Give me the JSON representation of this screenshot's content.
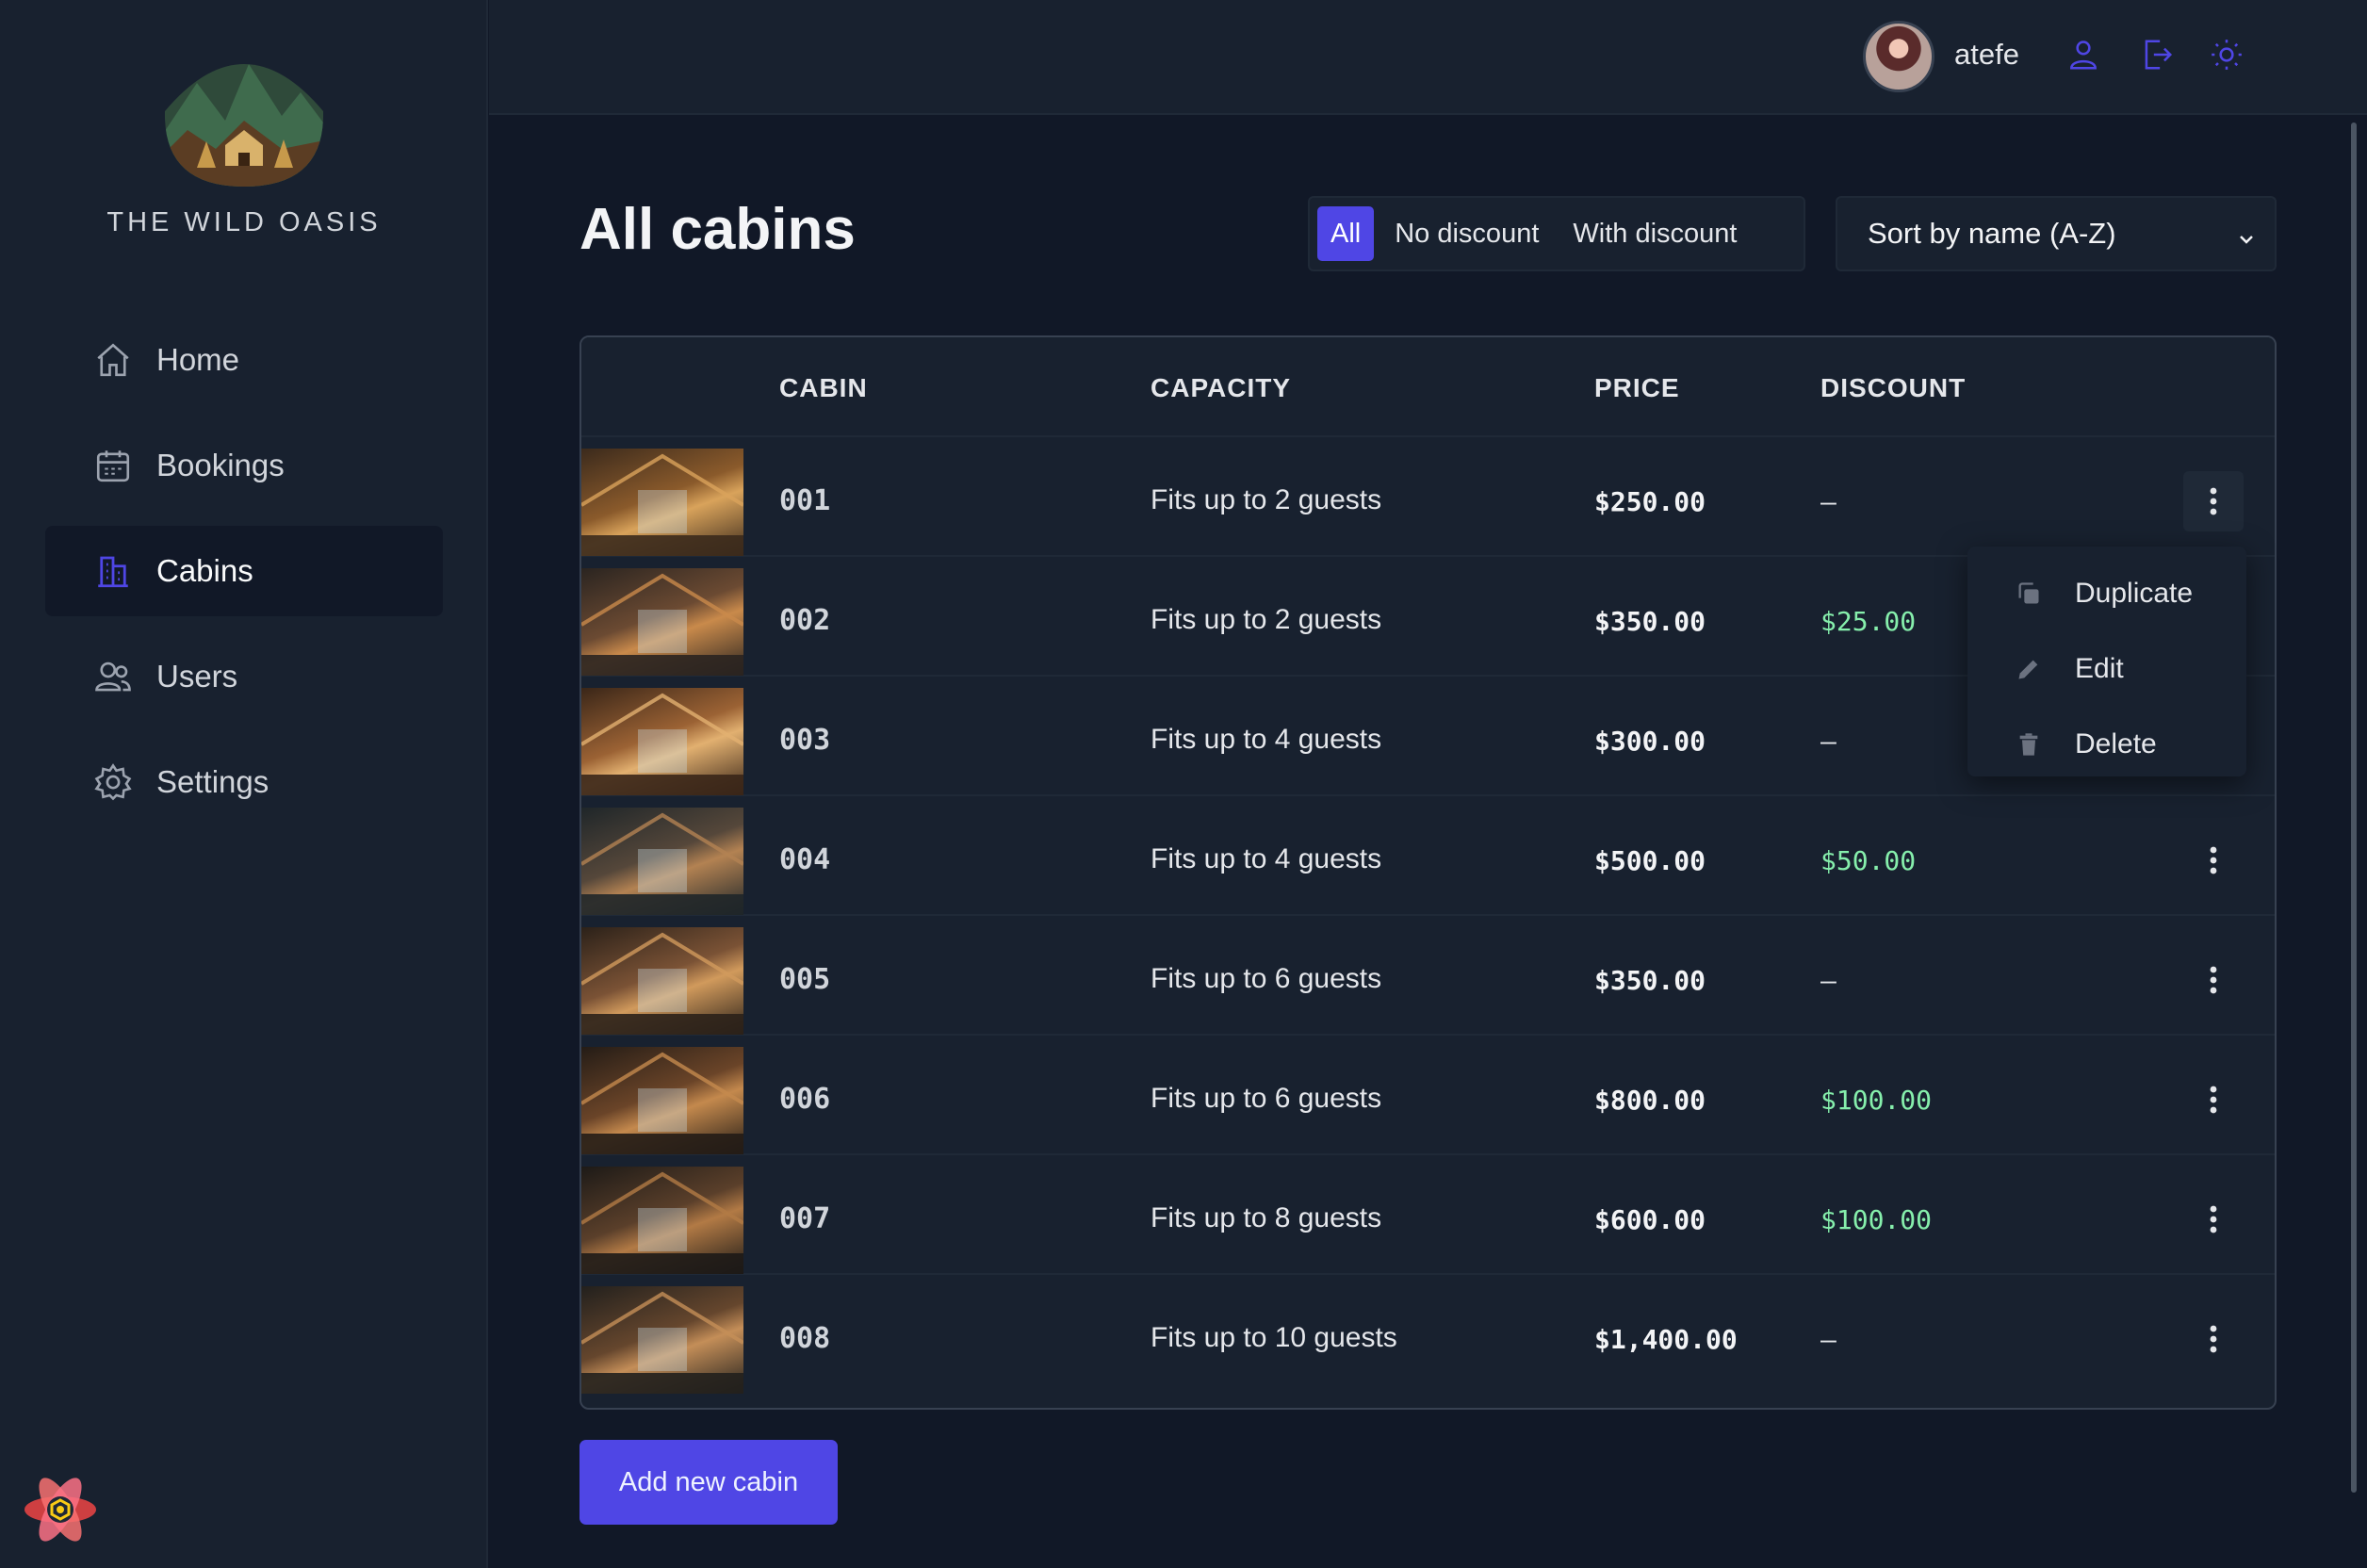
{
  "brand": {
    "name": "THE WILD OASIS",
    "logo_icon": "mountain-cabin-logo"
  },
  "sidebar": {
    "items": [
      {
        "label": "Home",
        "icon": "home-icon",
        "active": false
      },
      {
        "label": "Bookings",
        "icon": "calendar-icon",
        "active": false
      },
      {
        "label": "Cabins",
        "icon": "building-icon",
        "active": true
      },
      {
        "label": "Users",
        "icon": "users-icon",
        "active": false
      },
      {
        "label": "Settings",
        "icon": "gear-icon",
        "active": false
      }
    ],
    "footer_icon": "react-query-devtools-icon"
  },
  "header": {
    "username": "atefe",
    "icons": [
      "user-icon",
      "logout-icon",
      "sun-icon"
    ]
  },
  "page": {
    "title": "All cabins",
    "filters": [
      {
        "label": "All",
        "active": true
      },
      {
        "label": "No discount",
        "active": false
      },
      {
        "label": "With discount",
        "active": false
      }
    ],
    "sort": {
      "selected": "Sort by name (A-Z)"
    }
  },
  "table": {
    "headers": {
      "image": "",
      "cabin": "CABIN",
      "capacity": "CAPACITY",
      "price": "PRICE",
      "discount": "DISCOUNT"
    },
    "rows": [
      {
        "cabin": "001",
        "capacity": "Fits up to 2 guests",
        "price": "$250.00",
        "discount": "—"
      },
      {
        "cabin": "002",
        "capacity": "Fits up to 2 guests",
        "price": "$350.00",
        "discount": "$25.00"
      },
      {
        "cabin": "003",
        "capacity": "Fits up to 4 guests",
        "price": "$300.00",
        "discount": "—"
      },
      {
        "cabin": "004",
        "capacity": "Fits up to 4 guests",
        "price": "$500.00",
        "discount": "$50.00"
      },
      {
        "cabin": "005",
        "capacity": "Fits up to 6 guests",
        "price": "$350.00",
        "discount": "—"
      },
      {
        "cabin": "006",
        "capacity": "Fits up to 6 guests",
        "price": "$800.00",
        "discount": "$100.00"
      },
      {
        "cabin": "007",
        "capacity": "Fits up to 8 guests",
        "price": "$600.00",
        "discount": "$100.00"
      },
      {
        "cabin": "008",
        "capacity": "Fits up to 10 guests",
        "price": "$1,400.00",
        "discount": "—"
      }
    ]
  },
  "context_menu": {
    "items": [
      {
        "label": "Duplicate",
        "icon": "duplicate-icon"
      },
      {
        "label": "Edit",
        "icon": "pencil-icon"
      },
      {
        "label": "Delete",
        "icon": "trash-icon"
      }
    ]
  },
  "actions": {
    "add_label": "Add new cabin"
  },
  "colors": {
    "accent": "#4f46e5",
    "discount": "#86efac",
    "background": "#111827",
    "surface": "#18212f"
  }
}
